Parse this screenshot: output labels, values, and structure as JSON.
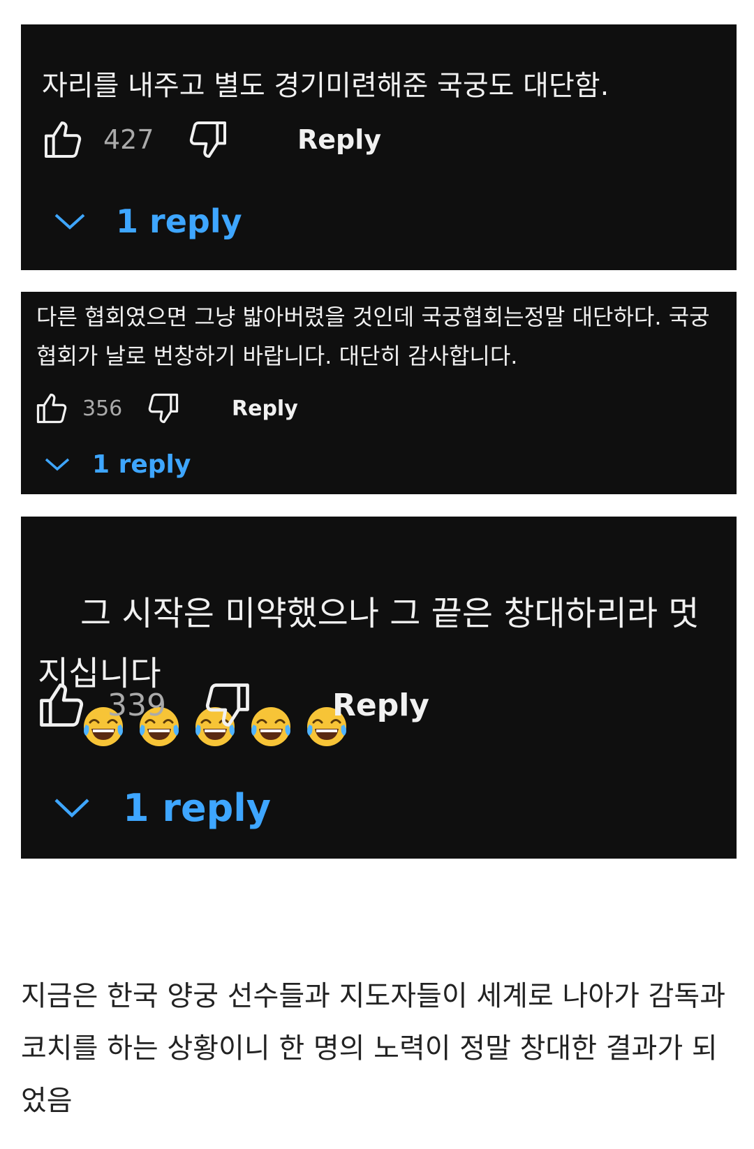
{
  "comments": [
    {
      "text": "자리를 내주고 별도 경기미련해준 국궁도 대단함.",
      "likes": "427",
      "reply_label": "Reply",
      "replies_label": "1 reply"
    },
    {
      "text": "다른 협회였으면 그냥 밟아버렸을 것인데 국궁협회는정말 대단하다. 국궁협회가 날로 번창하기 바랍니다. 대단히 감사합니다.",
      "likes": "356",
      "reply_label": "Reply",
      "replies_label": "1 reply"
    },
    {
      "text": "그 시작은 미약했으나 그 끝은 창대하리라 멋지십니다",
      "emoji": [
        "face-with-tears-of-joy-icon",
        "face-with-tears-of-joy-icon",
        "face-with-tears-of-joy-icon",
        "face-with-tears-of-joy-icon",
        "face-with-tears-of-joy-icon"
      ],
      "likes": "339",
      "reply_label": "Reply",
      "replies_label": "1 reply"
    }
  ],
  "article": {
    "text": "지금은 한국 양궁 선수들과 지도자들이 세계로 나아가 감독과 코치를 하는 상황이니 한 명의 노력이 정말 창대한 결과가 되었음"
  },
  "colors": {
    "card_bg": "#0f0f0f",
    "text": "#f1f1f1",
    "count": "#aaaaaa",
    "link": "#3ea6ff",
    "page_bg": "#ffffff"
  }
}
